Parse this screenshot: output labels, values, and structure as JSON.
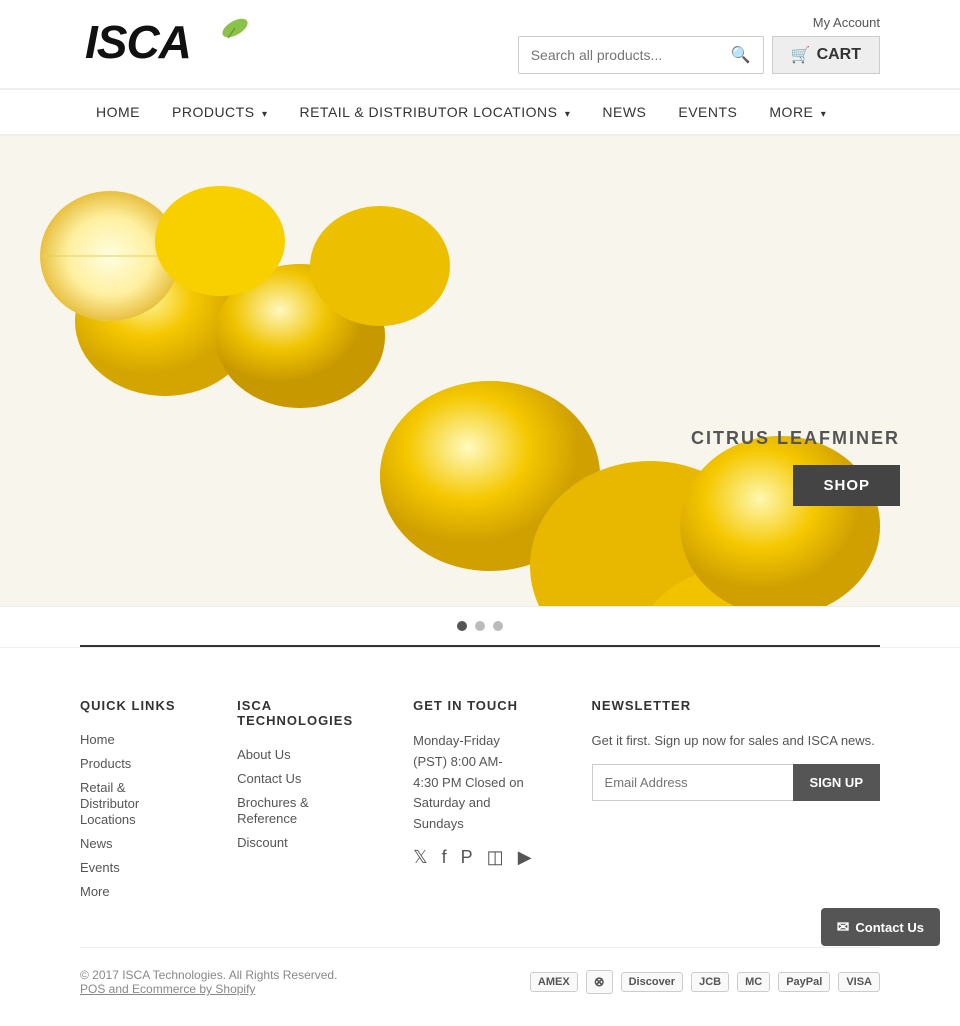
{
  "header": {
    "logo_text": "ISCA",
    "account_label": "My Account",
    "cart_label": "CART",
    "search_placeholder": "Search all products..."
  },
  "nav": {
    "items": [
      {
        "label": "HOME",
        "href": "#",
        "has_dropdown": false
      },
      {
        "label": "PRODUCTS",
        "href": "#",
        "has_dropdown": true
      },
      {
        "label": "RETAIL & DISTRIBUTOR LOCATIONS",
        "href": "#",
        "has_dropdown": true
      },
      {
        "label": "NEWS",
        "href": "#",
        "has_dropdown": false
      },
      {
        "label": "EVENTS",
        "href": "#",
        "has_dropdown": false
      },
      {
        "label": "MORE",
        "href": "#",
        "has_dropdown": true
      }
    ]
  },
  "hero": {
    "product_label": "CITRUS LEAFMINER",
    "shop_button": "SHOP",
    "dots": [
      1,
      2,
      3
    ],
    "active_dot": 0
  },
  "footer": {
    "quick_links_title": "QUICK LINKS",
    "quick_links": [
      {
        "label": "Home",
        "href": "#"
      },
      {
        "label": "Products",
        "href": "#"
      },
      {
        "label": "Retail & Distributor Locations",
        "href": "#"
      },
      {
        "label": "News",
        "href": "#"
      },
      {
        "label": "Events",
        "href": "#"
      },
      {
        "label": "More",
        "href": "#"
      }
    ],
    "isca_title": "ISCA TECHNOLOGIES",
    "isca_links": [
      {
        "label": "About Us",
        "href": "#"
      },
      {
        "label": "Contact Us",
        "href": "#"
      },
      {
        "label": "Brochures & Reference",
        "href": "#"
      },
      {
        "label": "Discount",
        "href": "#"
      }
    ],
    "get_in_touch_title": "GET IN TOUCH",
    "contact_text": "Monday-Friday (PST) 8:00 AM- 4:30 PM Closed on Saturday and Sundays",
    "social": {
      "twitter": "Twitter",
      "facebook": "Facebook",
      "pinterest": "Pinterest",
      "instagram": "Instagram",
      "youtube": "YouTube"
    },
    "newsletter_title": "NEWSLETTER",
    "newsletter_desc": "Get it first. Sign up now for sales and ISCA news.",
    "newsletter_placeholder": "Email Address",
    "newsletter_button": "SIGN UP",
    "copyright": "© 2017 ISCA Technologies. All Rights Reserved.",
    "footer_links": "POS and Ecommerce by Shopify",
    "payment_icons": [
      "AMEX",
      "VISA",
      "Discover",
      "JCB",
      "Master",
      "PayPal",
      "Visa"
    ]
  },
  "floating_contact": {
    "label": "Contact Us",
    "icon": "✉"
  }
}
